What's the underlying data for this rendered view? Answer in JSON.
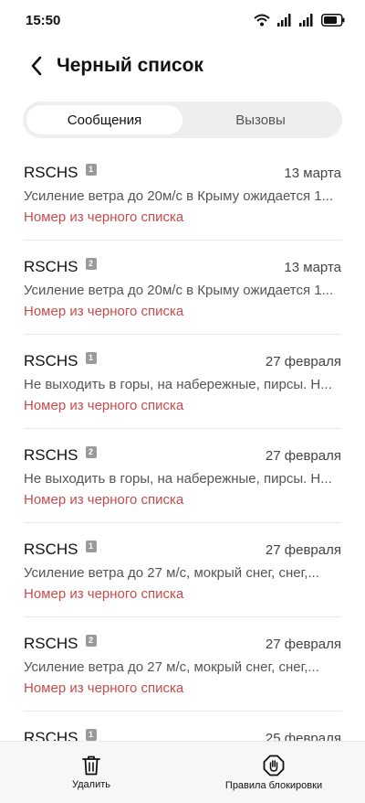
{
  "status_bar": {
    "time": "15:50",
    "icons": [
      "wifi-icon",
      "signal-icon",
      "signal-icon",
      "battery-icon"
    ]
  },
  "header": {
    "back_icon": "chevron-left-icon",
    "title": "Черный список"
  },
  "tabs": [
    {
      "label": "Сообщения",
      "active": true
    },
    {
      "label": "Вызовы",
      "active": false
    }
  ],
  "messages": [
    {
      "sender": "RSCHS",
      "sim": "1",
      "date": "13 марта",
      "preview": "Усиление ветра до 20м/с в Крыму ожидается 1...",
      "status": "Номер из черного списка"
    },
    {
      "sender": "RSCHS",
      "sim": "2",
      "date": "13 марта",
      "preview": "Усиление ветра до 20м/с в Крыму ожидается 1...",
      "status": "Номер из черного списка"
    },
    {
      "sender": "RSCHS",
      "sim": "1",
      "date": "27 февраля",
      "preview": "Не выходить в горы, на набережные, пирсы. Н...",
      "status": "Номер из черного списка"
    },
    {
      "sender": "RSCHS",
      "sim": "2",
      "date": "27 февраля",
      "preview": "Не выходить в горы, на набережные, пирсы. Н...",
      "status": "Номер из черного списка"
    },
    {
      "sender": "RSCHS",
      "sim": "1",
      "date": "27 февраля",
      "preview": "Усиление ветра до 27 м/с, мокрый снег, снег,...",
      "status": "Номер из черного списка"
    },
    {
      "sender": "RSCHS",
      "sim": "2",
      "date": "27 февраля",
      "preview": "Усиление ветра до 27 м/с, мокрый снег, снег,...",
      "status": "Номер из черного списка"
    },
    {
      "sender": "RSCHS",
      "sim": "1",
      "date": "25 февраля",
      "preview": "",
      "status": ""
    }
  ],
  "bottom_bar": {
    "delete": {
      "label": "Удалить",
      "icon": "trash-icon"
    },
    "rules": {
      "label": "Правила блокировки",
      "icon": "block-hand-icon"
    }
  },
  "colors": {
    "blocked_text": "#c94b4b",
    "segment_bg": "#eeeeee"
  }
}
